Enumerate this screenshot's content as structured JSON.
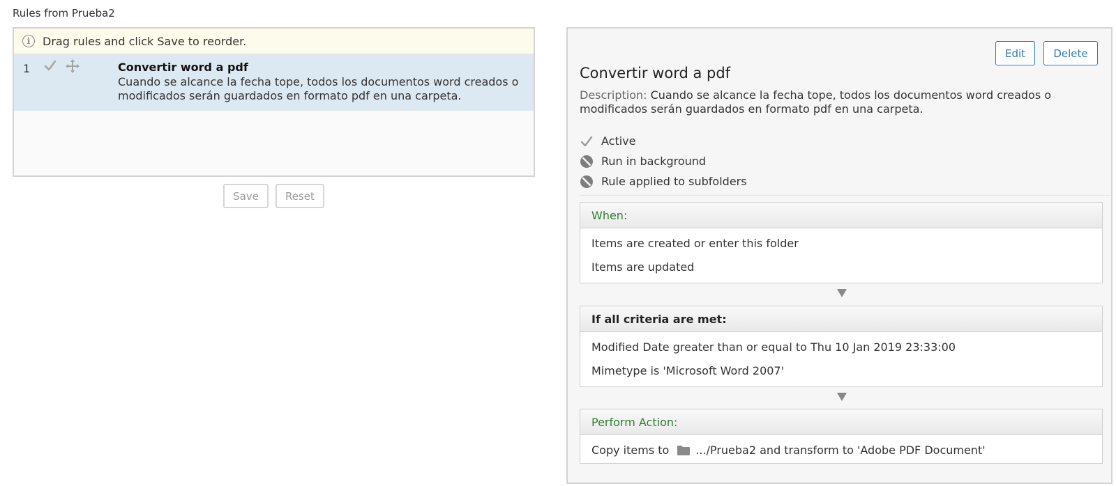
{
  "page": {
    "title": "Rules from Prueba2"
  },
  "rules_list": {
    "info_text": "Drag rules and click Save to reorder.",
    "rules": [
      {
        "index": "1",
        "name": "Convertir word a pdf",
        "description": "Cuando se alcance la fecha tope, todos los documentos word creados o modificados serán guardados en formato pdf en una carpeta."
      }
    ],
    "save_label": "Save",
    "reset_label": "Reset"
  },
  "details": {
    "edit_label": "Edit",
    "delete_label": "Delete",
    "title": "Convertir word a pdf",
    "description_label": "Description:",
    "description": "Cuando se alcance la fecha tope, todos los documentos word creados o modificados serán guardados en formato pdf en una carpeta.",
    "flags": [
      {
        "label": "Active",
        "icon": "check-icon",
        "enabled": true
      },
      {
        "label": "Run in background",
        "icon": "disabled-icon",
        "enabled": false
      },
      {
        "label": "Rule applied to subfolders",
        "icon": "disabled-icon",
        "enabled": false
      }
    ],
    "when": {
      "header": "When:",
      "items": [
        "Items are created or enter this folder",
        "Items are updated"
      ]
    },
    "criteria": {
      "header": "If all criteria are met:",
      "items": [
        "Modified Date greater than or equal to Thu 10 Jan 2019 23:33:00",
        "Mimetype is 'Microsoft Word 2007'"
      ]
    },
    "action": {
      "header": "Perform Action:",
      "prefix": "Copy items to",
      "folder_icon": "folder-icon",
      "suffix": ".../Prueba2 and transform to 'Adobe PDF Document'"
    }
  },
  "colors": {
    "accent": "#2a7ab8",
    "selected_row": "#dde9f2",
    "info_bg": "#fdfcec",
    "header_green": "#2f7d2f"
  }
}
